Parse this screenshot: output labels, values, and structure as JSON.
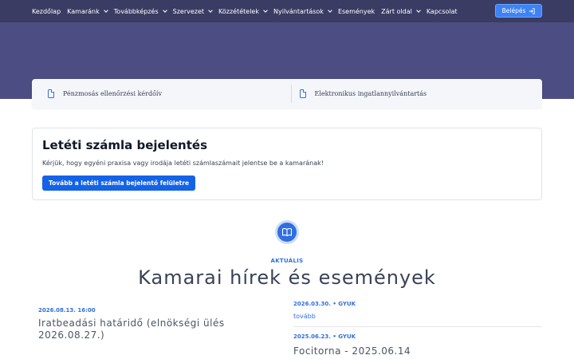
{
  "nav": {
    "items": [
      {
        "label": "Kezdőlap",
        "dropdown": false
      },
      {
        "label": "Kamaránk",
        "dropdown": true
      },
      {
        "label": "Továbbképzés",
        "dropdown": true
      },
      {
        "label": "Szervezet",
        "dropdown": true
      },
      {
        "label": "Közzétételek",
        "dropdown": true
      },
      {
        "label": "Nyilvántartások",
        "dropdown": true
      },
      {
        "label": "Események",
        "dropdown": false
      },
      {
        "label": "Zárt oldal",
        "dropdown": true
      },
      {
        "label": "Kapcsolat",
        "dropdown": false
      }
    ],
    "login_label": "Belépés"
  },
  "quick_links": [
    {
      "label": "Pénzmosás ellenőrzési kérdőív",
      "icon": "document-icon"
    },
    {
      "label": "Elektronikus ingatlannyilvántartás",
      "icon": "document-icon"
    }
  ],
  "deposit": {
    "title": "Letéti számla bejelentés",
    "text": "Kérjük, hogy egyéni praxisa vagy irodája letéti számlaszámait jelentse be a kamarának!",
    "button": "Tovább a letéti számla bejelentő felületre"
  },
  "section": {
    "icon": "book-icon",
    "eyebrow": "AKTUÁLIS",
    "title": "Kamarai hírek és események"
  },
  "news_left": {
    "meta": "2026.08.13. 16:00",
    "title": "Iratbeadási határidő (elnökségi ülés 2026.08.27.)"
  },
  "news_right": [
    {
      "meta": "2026.03.30. • GYUK",
      "link": "tovább"
    },
    {
      "meta": "2025.06.23. • GYUK",
      "title": "Focitorna - 2025.06.14"
    }
  ],
  "colors": {
    "nav_bg": "#3b3c63",
    "hero_bg": "#4b4d83",
    "accent": "#2f6fe0",
    "button": "#1463e6"
  }
}
